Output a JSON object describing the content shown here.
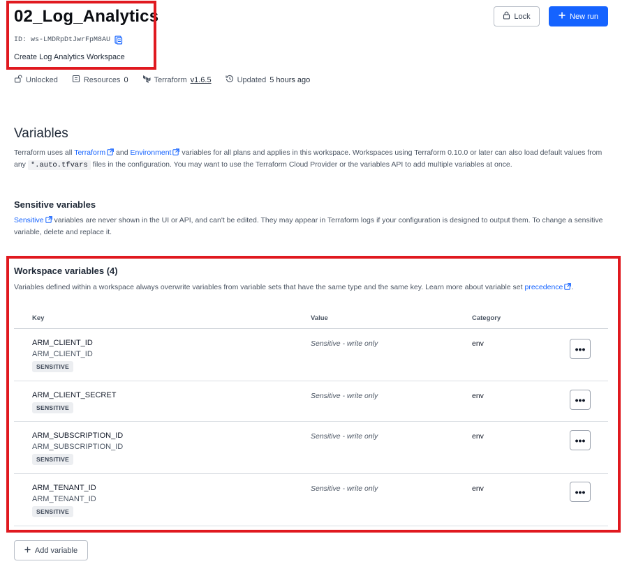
{
  "workspace": {
    "title": "02_Log_Analytics",
    "id": "ID: ws-LMDRpDtJwrFpM8AU",
    "description": "Create Log Analytics Workspace"
  },
  "header_buttons": {
    "lock_label": "Lock",
    "new_run_label": "New run"
  },
  "meta": {
    "lock_state": "Unlocked",
    "resources_label": "Resources",
    "resources_count": "0",
    "terraform_label": "Terraform",
    "terraform_version": "v1.6.5",
    "updated_label": "Updated",
    "updated_value": "5 hours ago"
  },
  "variables_section": {
    "heading": "Variables",
    "p1": "Terraform uses all",
    "link_terraform": "Terraform",
    "and": "and",
    "link_environment": "Environment",
    "p2": "variables for all plans and applies in this workspace. Workspaces using Terraform 0.10.0 or later can also load default values from any",
    "code": "*.auto.tfvars",
    "p3": "files in the configuration. You may want to use the Terraform Cloud Provider or the variables API to add multiple variables at once."
  },
  "sensitive_section": {
    "heading": "Sensitive variables",
    "link_sensitive": "Sensitive",
    "text": "variables are never shown in the UI or API, and can't be edited. They may appear in Terraform logs if your configuration is designed to output them. To change a sensitive variable, delete and replace it."
  },
  "workspace_variables": {
    "heading": "Workspace variables (4)",
    "text": "Variables defined within a workspace always overwrite variables from variable sets that have the same type and the same key. Learn more about variable set",
    "link_precedence": "precedence",
    "period": ".",
    "columns": {
      "key": "Key",
      "value": "Value",
      "category": "Category"
    },
    "rows": [
      {
        "key": "ARM_CLIENT_ID",
        "description": "ARM_CLIENT_ID",
        "badge": "SENSITIVE",
        "value": "Sensitive - write only",
        "category": "env",
        "more": "•••"
      },
      {
        "key": "ARM_CLIENT_SECRET",
        "description": "",
        "badge": "SENSITIVE",
        "value": "Sensitive - write only",
        "category": "env",
        "more": "•••"
      },
      {
        "key": "ARM_SUBSCRIPTION_ID",
        "description": "ARM_SUBSCRIPTION_ID",
        "badge": "SENSITIVE",
        "value": "Sensitive - write only",
        "category": "env",
        "more": "•••"
      },
      {
        "key": "ARM_TENANT_ID",
        "description": "ARM_TENANT_ID",
        "badge": "SENSITIVE",
        "value": "Sensitive - write only",
        "category": "env",
        "more": "•••"
      }
    ]
  },
  "add_variable_label": "Add variable",
  "colors": {
    "accent": "#1563ff",
    "highlight": "#e0191f"
  }
}
